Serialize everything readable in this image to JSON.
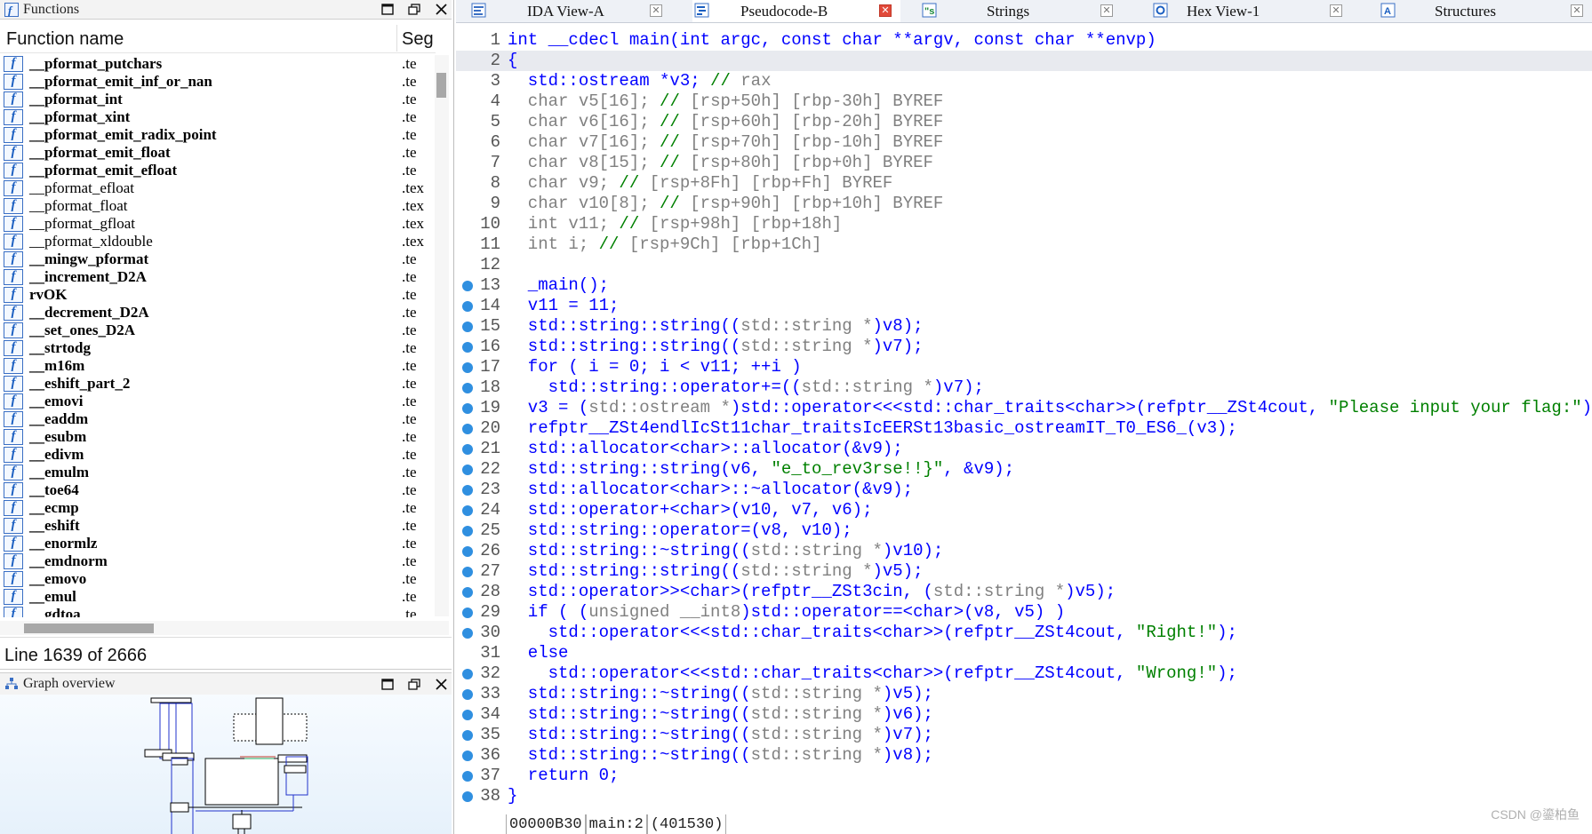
{
  "functions_panel": {
    "title": "Functions",
    "columns": [
      "Function name",
      "Seg"
    ],
    "rows": [
      {
        "name": "__pformat_putchars",
        "seg": ".te",
        "bold": true
      },
      {
        "name": "__pformat_emit_inf_or_nan",
        "seg": ".te",
        "bold": true
      },
      {
        "name": "__pformat_int",
        "seg": ".te",
        "bold": true
      },
      {
        "name": "__pformat_xint",
        "seg": ".te",
        "bold": true
      },
      {
        "name": "__pformat_emit_radix_point",
        "seg": ".te",
        "bold": true
      },
      {
        "name": "__pformat_emit_float",
        "seg": ".te",
        "bold": true
      },
      {
        "name": "__pformat_emit_efloat",
        "seg": ".te",
        "bold": true
      },
      {
        "name": "__pformat_efloat",
        "seg": ".tex",
        "bold": false
      },
      {
        "name": "__pformat_float",
        "seg": ".tex",
        "bold": false
      },
      {
        "name": "__pformat_gfloat",
        "seg": ".tex",
        "bold": false
      },
      {
        "name": "__pformat_xldouble",
        "seg": ".tex",
        "bold": false
      },
      {
        "name": "__mingw_pformat",
        "seg": ".te",
        "bold": true
      },
      {
        "name": "__increment_D2A",
        "seg": ".te",
        "bold": true
      },
      {
        "name": "rvOK",
        "seg": ".te",
        "bold": true
      },
      {
        "name": "__decrement_D2A",
        "seg": ".te",
        "bold": true
      },
      {
        "name": "__set_ones_D2A",
        "seg": ".te",
        "bold": true
      },
      {
        "name": "__strtodg",
        "seg": ".te",
        "bold": true
      },
      {
        "name": "__m16m",
        "seg": ".te",
        "bold": true
      },
      {
        "name": "__eshift_part_2",
        "seg": ".te",
        "bold": true
      },
      {
        "name": "__emovi",
        "seg": ".te",
        "bold": true
      },
      {
        "name": "__eaddm",
        "seg": ".te",
        "bold": true
      },
      {
        "name": "__esubm",
        "seg": ".te",
        "bold": true
      },
      {
        "name": "__edivm",
        "seg": ".te",
        "bold": true
      },
      {
        "name": "__emulm",
        "seg": ".te",
        "bold": true
      },
      {
        "name": "__toe64",
        "seg": ".te",
        "bold": true
      },
      {
        "name": "__ecmp",
        "seg": ".te",
        "bold": true
      },
      {
        "name": "__eshift",
        "seg": ".te",
        "bold": true
      },
      {
        "name": "__enormlz",
        "seg": ".te",
        "bold": true
      },
      {
        "name": "__emdnorm",
        "seg": ".te",
        "bold": true
      },
      {
        "name": "__emovo",
        "seg": ".te",
        "bold": true
      },
      {
        "name": "__emul",
        "seg": ".te",
        "bold": true
      },
      {
        "name": "__gdtoa",
        "seg": ".te",
        "bold": true
      }
    ],
    "line_status": "Line 1639 of 2666"
  },
  "graph_panel": {
    "title": "Graph overview"
  },
  "tabs": [
    {
      "label": "IDA View-A",
      "active": false
    },
    {
      "label": "Pseudocode-B",
      "active": true
    },
    {
      "label": "Strings",
      "active": false
    },
    {
      "label": "Hex View-1",
      "active": false
    },
    {
      "label": "Structures",
      "active": false
    }
  ],
  "code_lines": [
    {
      "n": "1",
      "bp": false,
      "hl": false,
      "segs": [
        [
          "k",
          "int __cdecl main(int argc, const char **argv, const char **envp)"
        ]
      ]
    },
    {
      "n": "2",
      "bp": false,
      "hl": true,
      "segs": [
        [
          "k",
          "{"
        ]
      ]
    },
    {
      "n": "3",
      "bp": false,
      "hl": false,
      "segs": [
        [
          "k",
          "  std::ostream *v3; "
        ],
        [
          "gr",
          "// "
        ],
        [
          "g",
          "rax"
        ]
      ]
    },
    {
      "n": "4",
      "bp": false,
      "hl": false,
      "segs": [
        [
          "g",
          "  char "
        ],
        [
          "g",
          "v5[16]; "
        ],
        [
          "gr",
          "// "
        ],
        [
          "g",
          "[rsp+50h] [rbp-30h] BYREF"
        ]
      ]
    },
    {
      "n": "5",
      "bp": false,
      "hl": false,
      "segs": [
        [
          "g",
          "  char v6[16]; "
        ],
        [
          "gr",
          "// "
        ],
        [
          "g",
          "[rsp+60h] [rbp-20h] BYREF"
        ]
      ]
    },
    {
      "n": "6",
      "bp": false,
      "hl": false,
      "segs": [
        [
          "g",
          "  char v7[16]; "
        ],
        [
          "gr",
          "// "
        ],
        [
          "g",
          "[rsp+70h] [rbp-10h] BYREF"
        ]
      ]
    },
    {
      "n": "7",
      "bp": false,
      "hl": false,
      "segs": [
        [
          "g",
          "  char v8[15]; "
        ],
        [
          "gr",
          "// "
        ],
        [
          "g",
          "[rsp+80h] [rbp+0h] BYREF"
        ]
      ]
    },
    {
      "n": "8",
      "bp": false,
      "hl": false,
      "segs": [
        [
          "g",
          "  char v9; "
        ],
        [
          "gr",
          "// "
        ],
        [
          "g",
          "[rsp+8Fh] [rbp+Fh] BYREF"
        ]
      ]
    },
    {
      "n": "9",
      "bp": false,
      "hl": false,
      "segs": [
        [
          "g",
          "  char v10[8]; "
        ],
        [
          "gr",
          "// "
        ],
        [
          "g",
          "[rsp+90h] [rbp+10h] BYREF"
        ]
      ]
    },
    {
      "n": "10",
      "bp": false,
      "hl": false,
      "segs": [
        [
          "g",
          "  int v11; "
        ],
        [
          "gr",
          "// "
        ],
        [
          "g",
          "[rsp+98h] [rbp+18h]"
        ]
      ]
    },
    {
      "n": "11",
      "bp": false,
      "hl": false,
      "segs": [
        [
          "g",
          "  int i; "
        ],
        [
          "gr",
          "// "
        ],
        [
          "g",
          "[rsp+9Ch] [rbp+1Ch]"
        ]
      ]
    },
    {
      "n": "12",
      "bp": false,
      "hl": false,
      "segs": [
        [
          "k",
          ""
        ]
      ]
    },
    {
      "n": "13",
      "bp": true,
      "hl": false,
      "segs": [
        [
          "k",
          "  _main();"
        ]
      ]
    },
    {
      "n": "14",
      "bp": true,
      "hl": false,
      "segs": [
        [
          "k",
          "  v11 = 11;"
        ]
      ]
    },
    {
      "n": "15",
      "bp": true,
      "hl": false,
      "segs": [
        [
          "k",
          "  std::string::string(("
        ],
        [
          "g",
          "std::string *"
        ],
        [
          "k",
          ")v8);"
        ]
      ]
    },
    {
      "n": "16",
      "bp": true,
      "hl": false,
      "segs": [
        [
          "k",
          "  std::string::string(("
        ],
        [
          "g",
          "std::string *"
        ],
        [
          "k",
          ")v7);"
        ]
      ]
    },
    {
      "n": "17",
      "bp": true,
      "hl": false,
      "segs": [
        [
          "k",
          "  for ( i = 0; i < v11; ++i )"
        ]
      ]
    },
    {
      "n": "18",
      "bp": true,
      "hl": false,
      "segs": [
        [
          "k",
          "    std::string::operator+=(("
        ],
        [
          "g",
          "std::string *"
        ],
        [
          "k",
          ")v7);"
        ]
      ]
    },
    {
      "n": "19",
      "bp": true,
      "hl": false,
      "segs": [
        [
          "k",
          "  v3 = ("
        ],
        [
          "g",
          "std::ostream *"
        ],
        [
          "k",
          ")std::operator<<<std::char_traits<char>>(refptr__ZSt4cout, "
        ],
        [
          "gr",
          "\"Please input your flag:\""
        ],
        [
          "k",
          ");"
        ]
      ]
    },
    {
      "n": "20",
      "bp": true,
      "hl": false,
      "segs": [
        [
          "k",
          "  refptr__ZSt4endlIcSt11char_traitsIcEERSt13basic_ostreamIT_T0_ES6_(v3);"
        ]
      ]
    },
    {
      "n": "21",
      "bp": true,
      "hl": false,
      "segs": [
        [
          "k",
          "  std::allocator<char>::allocator(&v9);"
        ]
      ]
    },
    {
      "n": "22",
      "bp": true,
      "hl": false,
      "segs": [
        [
          "k",
          "  std::string::string(v6, "
        ],
        [
          "gr",
          "\"e_to_rev3rse!!}\""
        ],
        [
          "k",
          ", &v9);"
        ]
      ]
    },
    {
      "n": "23",
      "bp": true,
      "hl": false,
      "segs": [
        [
          "k",
          "  std::allocator<char>::~allocator(&v9);"
        ]
      ]
    },
    {
      "n": "24",
      "bp": true,
      "hl": false,
      "segs": [
        [
          "k",
          "  std::operator+<char>(v10, v7, v6);"
        ]
      ]
    },
    {
      "n": "25",
      "bp": true,
      "hl": false,
      "segs": [
        [
          "k",
          "  std::string::operator=(v8, v10);"
        ]
      ]
    },
    {
      "n": "26",
      "bp": true,
      "hl": false,
      "segs": [
        [
          "k",
          "  std::string::~string(("
        ],
        [
          "g",
          "std::string *"
        ],
        [
          "k",
          ")v10);"
        ]
      ]
    },
    {
      "n": "27",
      "bp": true,
      "hl": false,
      "segs": [
        [
          "k",
          "  std::string::string(("
        ],
        [
          "g",
          "std::string *"
        ],
        [
          "k",
          ")v5);"
        ]
      ]
    },
    {
      "n": "28",
      "bp": true,
      "hl": false,
      "segs": [
        [
          "k",
          "  std::operator>><char>(refptr__ZSt3cin, ("
        ],
        [
          "g",
          "std::string *"
        ],
        [
          "k",
          ")v5);"
        ]
      ]
    },
    {
      "n": "29",
      "bp": true,
      "hl": false,
      "segs": [
        [
          "k",
          "  if ( ("
        ],
        [
          "g",
          "unsigned __int8"
        ],
        [
          "k",
          ")std::operator==<char>(v8, v5) )"
        ]
      ]
    },
    {
      "n": "30",
      "bp": true,
      "hl": false,
      "segs": [
        [
          "k",
          "    std::operator<<<std::char_traits<char>>(refptr__ZSt4cout, "
        ],
        [
          "gr",
          "\"Right!\""
        ],
        [
          "k",
          ");"
        ]
      ]
    },
    {
      "n": "31",
      "bp": false,
      "hl": false,
      "segs": [
        [
          "k",
          "  else"
        ]
      ]
    },
    {
      "n": "32",
      "bp": true,
      "hl": false,
      "segs": [
        [
          "k",
          "    std::operator<<<std::char_traits<char>>(refptr__ZSt4cout, "
        ],
        [
          "gr",
          "\"Wrong!\""
        ],
        [
          "k",
          ");"
        ]
      ]
    },
    {
      "n": "33",
      "bp": true,
      "hl": false,
      "segs": [
        [
          "k",
          "  std::string::~string(("
        ],
        [
          "g",
          "std::string *"
        ],
        [
          "k",
          ")v5);"
        ]
      ]
    },
    {
      "n": "34",
      "bp": true,
      "hl": false,
      "segs": [
        [
          "k",
          "  std::string::~string(("
        ],
        [
          "g",
          "std::string *"
        ],
        [
          "k",
          ")v6);"
        ]
      ]
    },
    {
      "n": "35",
      "bp": true,
      "hl": false,
      "segs": [
        [
          "k",
          "  std::string::~string(("
        ],
        [
          "g",
          "std::string *"
        ],
        [
          "k",
          ")v7);"
        ]
      ]
    },
    {
      "n": "36",
      "bp": true,
      "hl": false,
      "segs": [
        [
          "k",
          "  std::string::~string(("
        ],
        [
          "g",
          "std::string *"
        ],
        [
          "k",
          ")v8);"
        ]
      ]
    },
    {
      "n": "37",
      "bp": true,
      "hl": false,
      "segs": [
        [
          "k",
          "  return 0;"
        ]
      ]
    },
    {
      "n": "38",
      "bp": true,
      "hl": false,
      "segs": [
        [
          "k",
          "}"
        ]
      ]
    }
  ],
  "status_bar": {
    "address": "00000B30",
    "location": "main:2",
    "ea": "(401530)"
  },
  "watermark": "CSDN @鎏柏鱼",
  "colors": {
    "keyword": "#0000ff",
    "comment_gray": "#808080",
    "string_green": "#008000",
    "breakpoint_dot": "#2f8fe0",
    "active_tab_close": "#e24a3a"
  }
}
